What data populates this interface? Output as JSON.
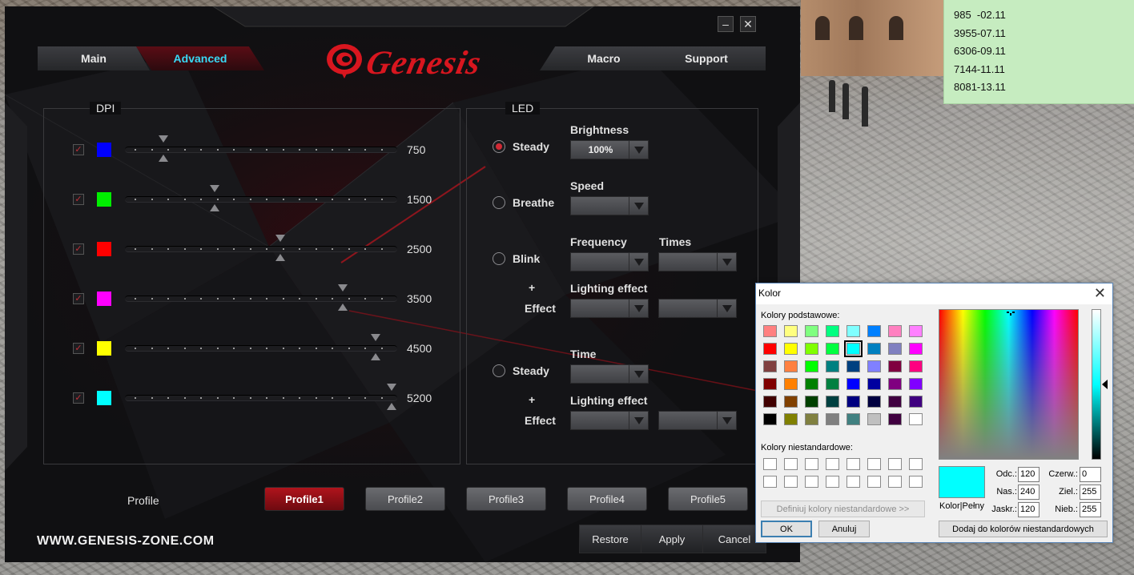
{
  "sticky_notes": [
    "985  -02.11",
    "3955-07.11",
    "6306-09.11",
    "7144-11.11",
    "8081-13.11"
  ],
  "app": {
    "tabs": {
      "main": "Main",
      "advanced": "Advanced",
      "macro": "Macro",
      "support": "Support"
    },
    "logo_text": "Genesis",
    "window_buttons": {
      "minimize": "–",
      "close": "✕"
    },
    "dpi": {
      "title": "DPI",
      "levels": [
        {
          "value": "750",
          "color": "#0000ff",
          "checked": true,
          "position": 0.14
        },
        {
          "value": "1500",
          "color": "#00ee00",
          "checked": true,
          "position": 0.33
        },
        {
          "value": "2500",
          "color": "#ff0000",
          "checked": true,
          "position": 0.57
        },
        {
          "value": "3500",
          "color": "#ff00ff",
          "checked": true,
          "position": 0.8
        },
        {
          "value": "4500",
          "color": "#ffff00",
          "checked": true,
          "position": 0.92
        },
        {
          "value": "5200",
          "color": "#00ffff",
          "checked": true,
          "position": 0.98
        }
      ]
    },
    "led": {
      "title": "LED",
      "steady": "Steady",
      "breathe": "Breathe",
      "blink": "Blink",
      "plus": "+",
      "effect": "Effect",
      "steady2": "Steady",
      "plus2": "+",
      "effect2": "Effect",
      "brightness_label": "Brightness",
      "brightness_value": "100%",
      "speed_label": "Speed",
      "frequency_label": "Frequency",
      "times_label": "Times",
      "lighting_effect_label": "Lighting effect",
      "time_label": "Time",
      "lighting_effect_label2": "Lighting effect"
    },
    "profile_label": "Profile",
    "profiles": [
      "Profile1",
      "Profile2",
      "Profile3",
      "Profile4",
      "Profile5"
    ],
    "active_profile": "Profile1",
    "website": "WWW.GENESIS-ZONE.COM",
    "buttons": {
      "restore": "Restore",
      "apply": "Apply",
      "cancel": "Cancel"
    }
  },
  "color_dialog": {
    "title": "Kolor",
    "close": "✕",
    "basic_colors_label": "Kolory podstawowe:",
    "basic_colors": [
      "#ff8080",
      "#ffff80",
      "#80ff80",
      "#00ff80",
      "#80ffff",
      "#0080ff",
      "#ff80c0",
      "#ff80ff",
      "#ff0000",
      "#ffff00",
      "#80ff00",
      "#00ff40",
      "#00ffff",
      "#0080c0",
      "#8080c0",
      "#ff00ff",
      "#804040",
      "#ff8040",
      "#00ff00",
      "#008080",
      "#004080",
      "#8080ff",
      "#800040",
      "#ff0080",
      "#800000",
      "#ff8000",
      "#008000",
      "#008040",
      "#0000ff",
      "#0000a0",
      "#800080",
      "#8000ff",
      "#400000",
      "#804000",
      "#004000",
      "#004040",
      "#000080",
      "#000040",
      "#400040",
      "#400080",
      "#000000",
      "#808000",
      "#808040",
      "#808080",
      "#408080",
      "#c0c0c0",
      "#400040",
      "#ffffff"
    ],
    "selected_index": 12,
    "custom_colors_label": "Kolory niestandardowe:",
    "define_button": "Definiuj kolory niestandardowe >>",
    "ok": "OK",
    "cancel": "Anuluj",
    "preview_label": "Kolor|Pełny",
    "preview_color": "#00ffff",
    "hue_label": "Odc.:",
    "hue": "120",
    "sat_label": "Nas.:",
    "sat": "240",
    "lum_label": "Jaskr.:",
    "lum": "120",
    "red_label": "Czerw.:",
    "red": "0",
    "green_label": "Ziel.:",
    "green": "255",
    "blue_label": "Nieb.:",
    "blue": "255",
    "add_custom_button": "Dodaj do kolorów niestandardowych"
  }
}
